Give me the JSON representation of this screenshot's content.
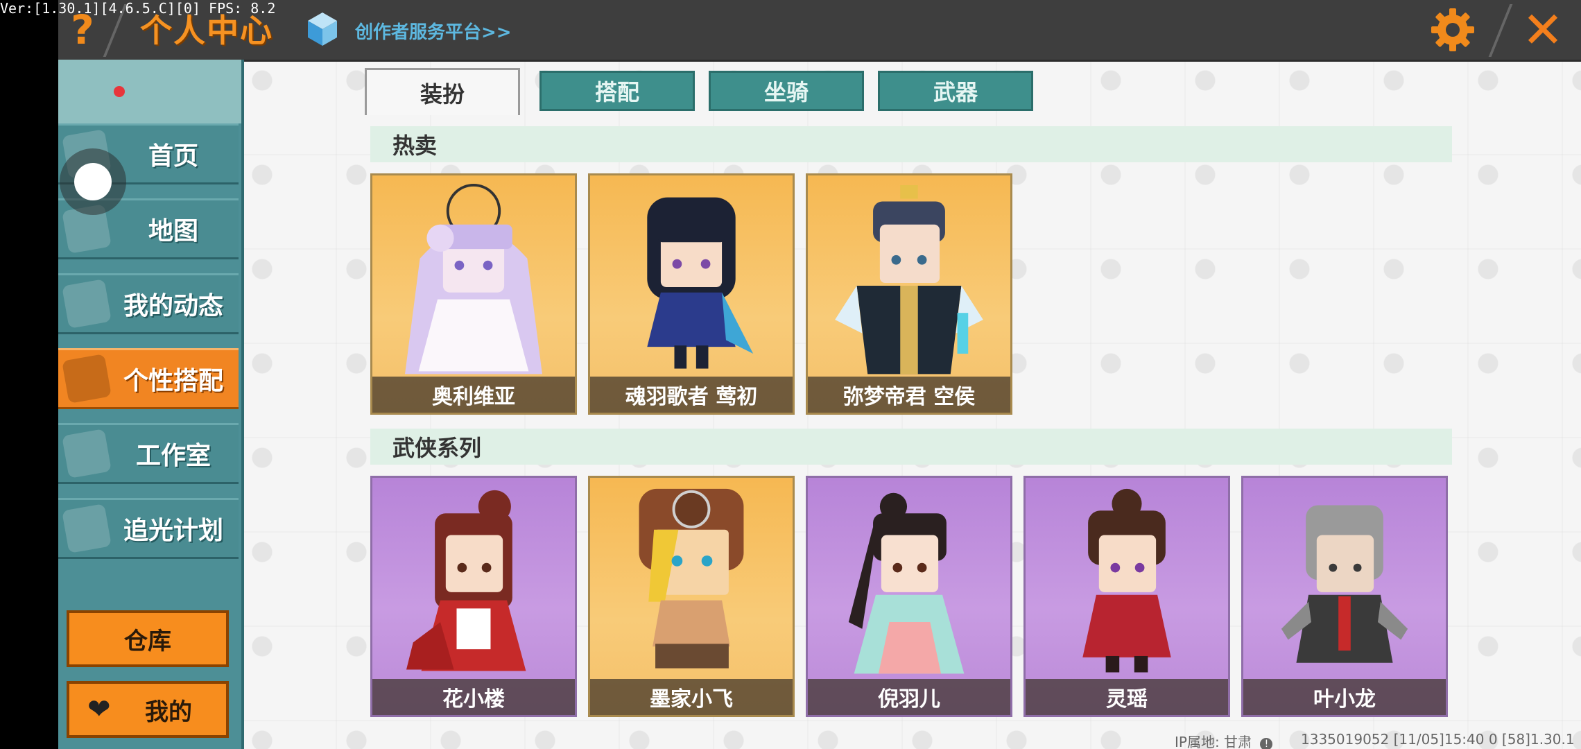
{
  "debug_text": "Ver:[1.30.1][4.6.5.C][0] FPS: 8.2",
  "header": {
    "help_symbol": "?",
    "title": "个人中心",
    "creator_link": "创作者服务平台>>",
    "close_symbol": "✕"
  },
  "sidebar": {
    "items": [
      {
        "label": "首页",
        "icon": "home-icon"
      },
      {
        "label": "地图",
        "icon": "map-icon"
      },
      {
        "label": "我的动态",
        "icon": "bell-icon"
      },
      {
        "label": "个性搭配",
        "icon": "outfit-icon",
        "active": true
      },
      {
        "label": "工作室",
        "icon": "studio-icon"
      },
      {
        "label": "追光计划",
        "icon": "plan-icon"
      }
    ],
    "warehouse_label": "仓库",
    "mine_label": "我的"
  },
  "tabs": [
    {
      "label": "装扮",
      "active": true
    },
    {
      "label": "搭配"
    },
    {
      "label": "坐骑"
    },
    {
      "label": "武器"
    }
  ],
  "sections": [
    {
      "title": "热卖",
      "cards": [
        {
          "name": "奥利维亚"
        },
        {
          "name": "魂羽歌者 莺初"
        },
        {
          "name": "弥梦帝君 空侯"
        }
      ]
    },
    {
      "title": "武侠系列",
      "cards": [
        {
          "name": "花小楼"
        },
        {
          "name": "墨家小飞"
        },
        {
          "name": "倪羽儿"
        },
        {
          "name": "灵瑶"
        },
        {
          "name": "叶小龙"
        }
      ]
    }
  ],
  "footer": {
    "ip_location": "IP属地: 甘肃",
    "info": "1335019052   [11/05]15:40 0   [58]1.30.1"
  },
  "colors": {
    "accent_orange": "#f18522",
    "teal": "#4a8c92",
    "card_gold": "#f6b852",
    "card_purple": "#b784d8"
  }
}
